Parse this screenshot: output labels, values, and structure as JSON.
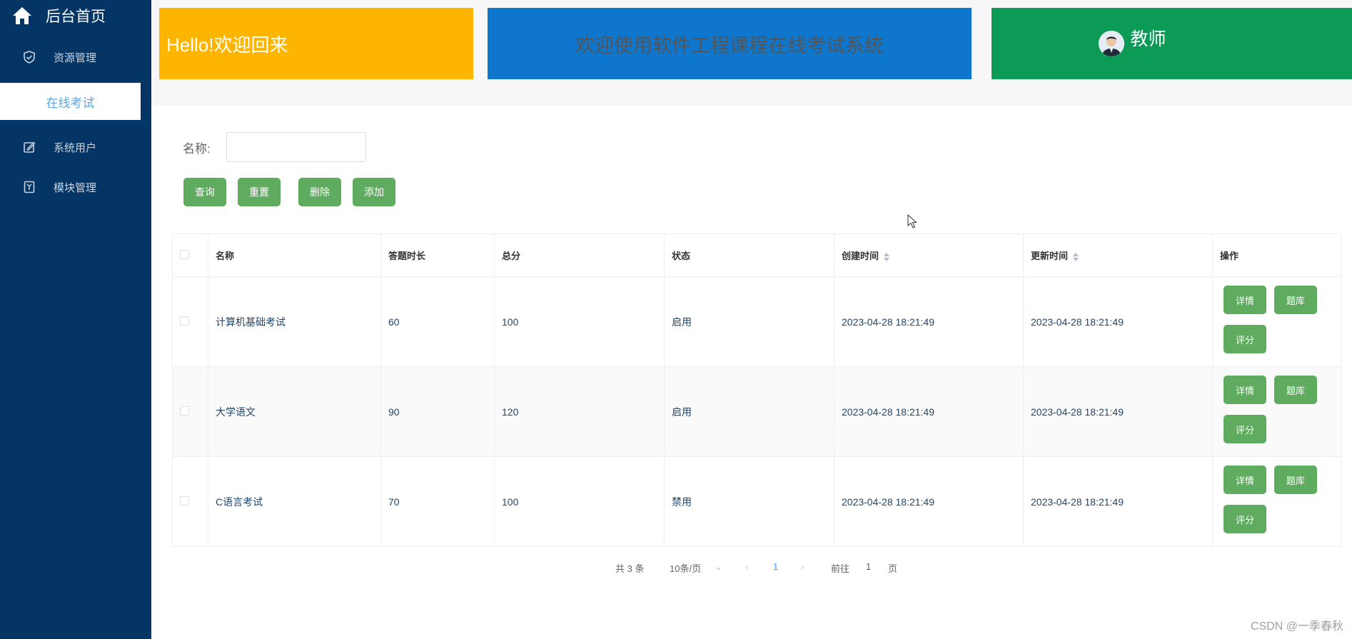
{
  "sidebar": {
    "home_label": "后台首页",
    "items": [
      {
        "label": "资源管理",
        "icon": "shield-icon"
      },
      {
        "label": "在线考试"
      },
      {
        "label": "系统用户",
        "icon": "edit-icon"
      },
      {
        "label": "模块管理",
        "icon": "bookmark-icon"
      }
    ]
  },
  "header": {
    "welcome": "Hello!欢迎回来",
    "system_title": "欢迎使用软件工程课程在线考试系统",
    "role": "教师"
  },
  "search": {
    "name_label": "名称:",
    "name_value": "",
    "buttons": {
      "query": "查询",
      "reset": "重置",
      "delete": "删除",
      "add": "添加"
    }
  },
  "table": {
    "headers": [
      "名称",
      "答题时长",
      "总分",
      "状态",
      "创建时间",
      "更新时间",
      "操作"
    ],
    "rows": [
      {
        "name": "计算机基础考试",
        "duration": "60",
        "score": "100",
        "status": "启用",
        "created": "2023-04-28 18:21:49",
        "updated": "2023-04-28 18:21:49"
      },
      {
        "name": "大学语文",
        "duration": "90",
        "score": "120",
        "status": "启用",
        "created": "2023-04-28 18:21:49",
        "updated": "2023-04-28 18:21:49"
      },
      {
        "name": "C语言考试",
        "duration": "70",
        "score": "100",
        "status": "禁用",
        "created": "2023-04-28 18:21:49",
        "updated": "2023-04-28 18:21:49"
      }
    ],
    "actions": {
      "detail": "详情",
      "bank": "题库",
      "grade": "评分"
    }
  },
  "pagination": {
    "total": "共 3 条",
    "page_size": "10条/页",
    "current": "1",
    "goto_label": "前往",
    "goto_value": "1",
    "page_suffix": "页"
  },
  "watermark": "CSDN @一季春秋",
  "colors": {
    "sidebar_bg": "#043565",
    "banner_yellow": "#feb500",
    "banner_blue": "#0e76cc",
    "banner_green": "#0c9b57",
    "button_green": "#5fab5f"
  }
}
